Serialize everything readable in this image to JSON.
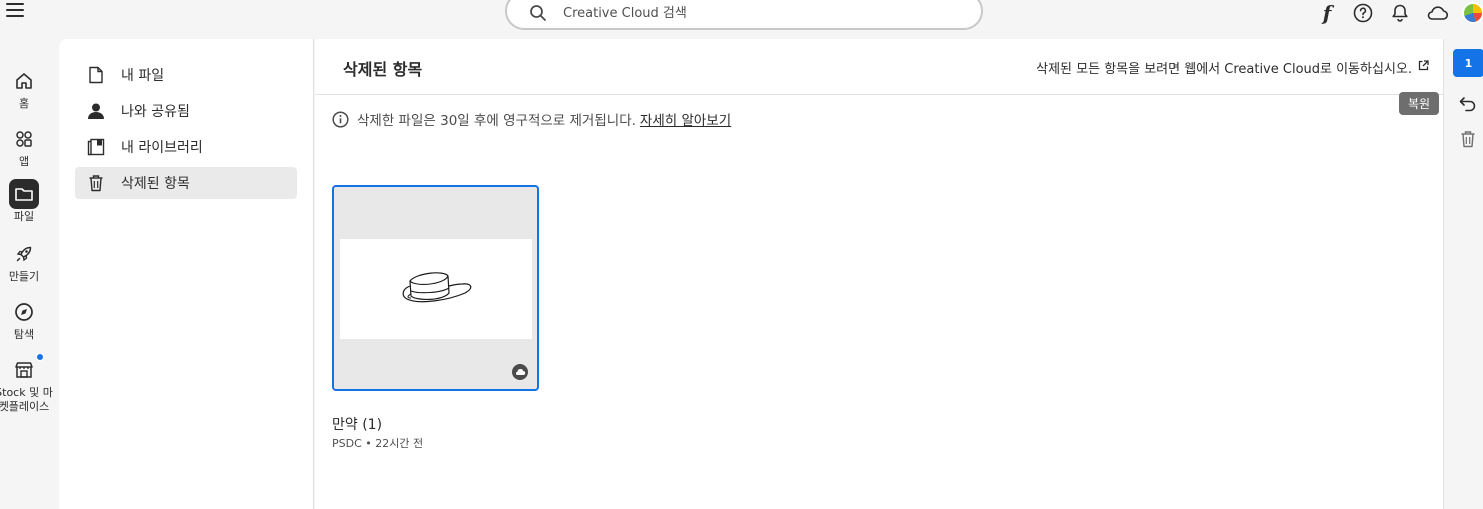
{
  "topbar": {
    "search_placeholder": "Creative Cloud 검색",
    "icons": [
      "menu-icon",
      "search-icon",
      "fonts-icon",
      "help-icon",
      "bell-icon",
      "cloud-icon",
      "avatar"
    ]
  },
  "rail": {
    "items": [
      {
        "label": "홈",
        "icon": "home-icon"
      },
      {
        "label": "앱",
        "icon": "apps-icon"
      },
      {
        "label": "파일",
        "icon": "folder-icon",
        "active": true
      },
      {
        "label": "만들기",
        "icon": "rocket-icon"
      },
      {
        "label": "탐색",
        "icon": "compass-icon"
      },
      {
        "label_line1": "Stock 및 마",
        "label_line2": "켓플레이스",
        "icon": "store-icon",
        "has_dot": true
      }
    ]
  },
  "sidebar": {
    "items": [
      {
        "label": "내 파일",
        "icon": "file-icon"
      },
      {
        "label": "나와 공유됨",
        "icon": "user-icon"
      },
      {
        "label": "내 라이브러리",
        "icon": "library-icon"
      },
      {
        "label": "삭제된 항목",
        "icon": "trash-icon",
        "active": true
      }
    ]
  },
  "main": {
    "title": "삭제된 항목",
    "web_link": "삭제된 모든 항목을 보려면 웹에서 Creative Cloud로 이동하십시오.",
    "notice": "삭제한 파일은 30일 후에 영구적으로 제거됩니다.",
    "learn_more": "자세히 알아보기",
    "files": [
      {
        "name": "만약 (1)",
        "meta": "PSDC • 22시간 전",
        "selected": true
      }
    ]
  },
  "right_strip": {
    "selected_count": "1",
    "restore_tooltip": "복원",
    "icons": [
      "restore-icon",
      "delete-icon"
    ]
  },
  "colors": {
    "accent": "#1473e6",
    "tooltip_bg": "#6e6e6e",
    "background": "#f5f5f5"
  }
}
